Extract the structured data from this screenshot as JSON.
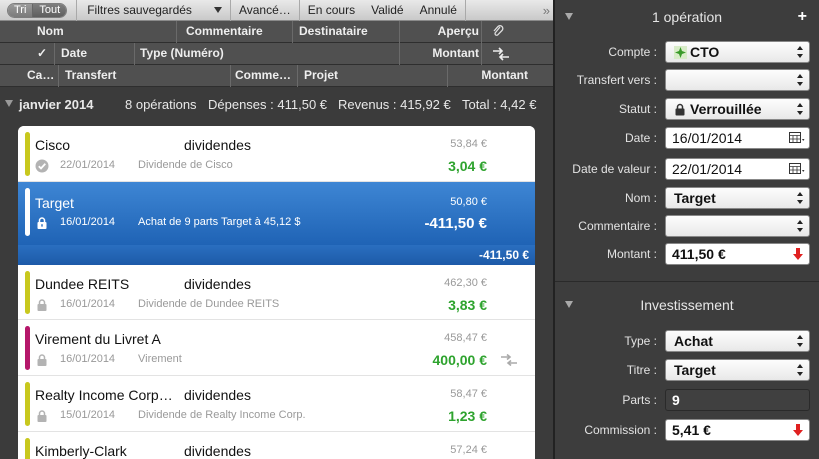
{
  "toolbar": {
    "sort_label": "Tri",
    "all_label": "Tout",
    "saved_filters_label": "Filtres sauvegardés",
    "advanced_label": "Avancé…",
    "pending_label": "En cours",
    "validated_label": "Validé",
    "cancelled_label": "Annulé"
  },
  "columns": {
    "row1": {
      "name": "Nom",
      "comment": "Commentaire",
      "recipient": "Destinataire",
      "preview": "Aperçu"
    },
    "row2": {
      "check": "✓",
      "date": "Date",
      "type": "Type (Numéro)",
      "amount": "Montant"
    },
    "row3": {
      "category": "Ca…",
      "transfer": "Transfert",
      "comment": "Comme…",
      "project": "Projet",
      "amount": "Montant"
    }
  },
  "group": {
    "month": "janvier 2014",
    "count": "8 opérations",
    "expenses": "Dépenses : 411,50 €",
    "income": "Revenus : 415,92 €",
    "total": "Total : 4,42 €"
  },
  "transactions": [
    {
      "name": "Cisco",
      "category": "dividendes",
      "date": "22/01/2014",
      "description": "Dividende de Cisco",
      "balance": "53,84 €",
      "amount": "3,04 €",
      "status": "validated",
      "color": "#c8c81e"
    },
    {
      "name": "Target",
      "category": "",
      "date": "16/01/2014",
      "description": "Achat de 9 parts Target à 45,12 $",
      "balance": "50,80 €",
      "amount": "-411,50 €",
      "sub_total": "-411,50 €",
      "status": "locked",
      "color": "#ffffff"
    },
    {
      "name": "Dundee REITS",
      "category": "dividendes",
      "date": "16/01/2014",
      "description": "Dividende de Dundee REITS",
      "balance": "462,30 €",
      "amount": "3,83 €",
      "status": "locked",
      "color": "#c8c81e"
    },
    {
      "name": "Virement du Livret A",
      "category": "",
      "date": "16/01/2014",
      "description": "Virement",
      "balance": "458,47 €",
      "amount": "400,00 €",
      "status": "locked",
      "color": "#b5176a"
    },
    {
      "name": "Realty Income Corp…",
      "category": "dividendes",
      "date": "15/01/2014",
      "description": "Dividende de Realty Income Corp.",
      "balance": "58,47 €",
      "amount": "1,23 €",
      "status": "locked",
      "color": "#c8c81e"
    },
    {
      "name": "Kimberly-Clark",
      "category": "dividendes",
      "date": "",
      "description": "",
      "balance": "57,24 €",
      "amount": "",
      "status": "",
      "color": "#c8c81e"
    }
  ],
  "inspector": {
    "title": "1 opération",
    "fields": {
      "account_label": "Compte :",
      "account_value": "CTO",
      "transfer_label": "Transfert vers :",
      "transfer_value": "",
      "status_label": "Statut :",
      "status_value": "Verrouillée",
      "date_label": "Date :",
      "date_value": "16/01/2014",
      "value_date_label": "Date de valeur :",
      "value_date_value": "22/01/2014",
      "name_label": "Nom :",
      "name_value": "Target",
      "comment_label": "Commentaire :",
      "comment_value": "",
      "amount_label": "Montant :",
      "amount_value": "411,50 €"
    },
    "investment": {
      "title": "Investissement",
      "type_label": "Type :",
      "type_value": "Achat",
      "security_label": "Titre :",
      "security_value": "Target",
      "shares_label": "Parts :",
      "shares_value": "9",
      "fee_label": "Commission :",
      "fee_value": "5,41 €"
    }
  },
  "colors": {
    "selection": "#1f63b5",
    "positive": "#2ea32e",
    "negative_arrow": "#e02020"
  }
}
